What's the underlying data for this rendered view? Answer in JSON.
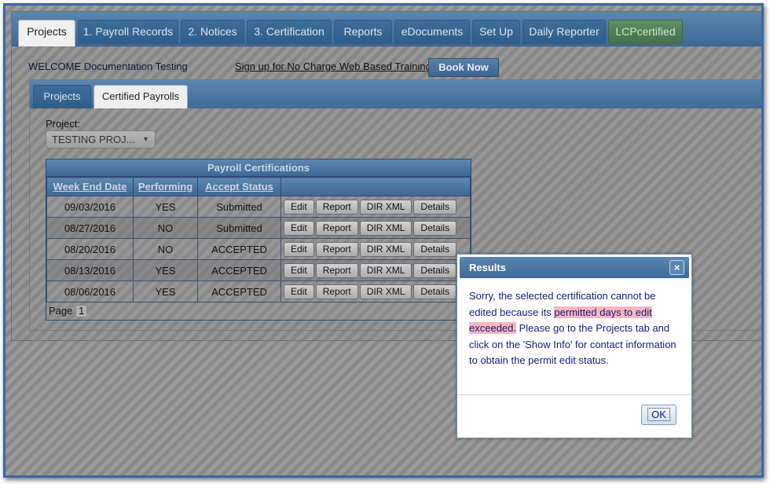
{
  "nav": {
    "tabs": [
      {
        "label": "Projects"
      },
      {
        "label": "1. Payroll Records"
      },
      {
        "label": "2. Notices"
      },
      {
        "label": "3. Certification"
      },
      {
        "label": "Reports"
      },
      {
        "label": "eDocuments"
      },
      {
        "label": "Set Up"
      },
      {
        "label": "Daily Reporter"
      },
      {
        "label": "LCPcertified"
      }
    ],
    "active": "Projects"
  },
  "header": {
    "welcome": "WELCOME Documentation Testing",
    "training_link": "Sign up for No Charge Web Based Training",
    "book_now": "Book Now"
  },
  "subnav": {
    "tabs": [
      {
        "label": "Projects"
      },
      {
        "label": "Certified Payrolls"
      }
    ],
    "active": "Certified Payrolls"
  },
  "project": {
    "label": "Project:",
    "selected": "TESTING PROJ..."
  },
  "grid": {
    "caption": "Payroll Certifications",
    "columns": [
      "Week End Date",
      "Performing",
      "Accept Status"
    ],
    "action_labels": {
      "edit": "Edit",
      "report": "Report",
      "dir_xml": "DIR XML",
      "details": "Details"
    },
    "rows": [
      {
        "date": "09/03/2016",
        "performing": "YES",
        "status": "Submitted"
      },
      {
        "date": "08/27/2016",
        "performing": "NO",
        "status": "Submitted"
      },
      {
        "date": "08/20/2016",
        "performing": "NO",
        "status": "ACCEPTED"
      },
      {
        "date": "08/13/2016",
        "performing": "YES",
        "status": "ACCEPTED"
      },
      {
        "date": "08/06/2016",
        "performing": "YES",
        "status": "ACCEPTED"
      }
    ],
    "pager": {
      "label": "Page",
      "current": "1"
    }
  },
  "dialog": {
    "title": "Results",
    "close_icon": "×",
    "message_pre": "Sorry, the selected certification cannot be edited because its",
    "message_highlight": "permitted days to edit exceeded.",
    "message_post": "Please go to the Projects tab and click on the 'Show Info' for contact information to obtain the permit edit status.",
    "ok_label": "OK"
  },
  "colors": {
    "nav_blue": "#3e6a96",
    "highlight": "#f7b6c1",
    "dialog_text": "#12207a",
    "frame_border": "#3b66a8"
  }
}
